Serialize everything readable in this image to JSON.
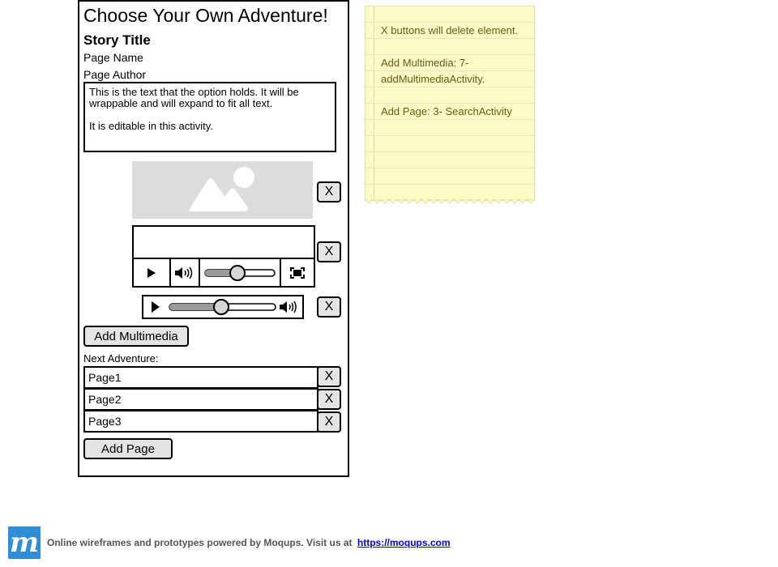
{
  "app": {
    "title": "Choose Your Own Adventure!",
    "story_title": "Story Title",
    "page_name": "Page Name",
    "page_author": "Page Author",
    "option_text": [
      "This is the text that the option holds. It will be wrappable and will expand to fit all text.",
      "It is editable in this activity."
    ]
  },
  "media": {
    "delete_label": "X",
    "image_icon": "image-placeholder-icon",
    "video_controls": [
      "play-icon",
      "volume-icon",
      "seek-slider",
      "fullscreen-icon"
    ],
    "video_progress": 0.48,
    "audio_controls": [
      "play-icon",
      "seek-slider",
      "volume-icon"
    ],
    "audio_progress": 0.48
  },
  "buttons": {
    "add_multimedia": "Add Multimedia",
    "add_page": "Add Page"
  },
  "next_adventure": {
    "label": "Next Adventure:",
    "pages": [
      "Page1",
      "Page2",
      "Page3"
    ]
  },
  "note": {
    "lines": [
      "X buttons will delete element.",
      "Add Multimedia: 7- addMultimediaActivity.",
      "Add Page: 3- SearchActivity"
    ],
    "color": "#fefbc6"
  },
  "footer": {
    "logo": "m",
    "text": "Online wireframes and prototypes powered by Moqups. Visit us at",
    "link": "https://moqups.com",
    "brand_color": "#2f8ed6"
  }
}
